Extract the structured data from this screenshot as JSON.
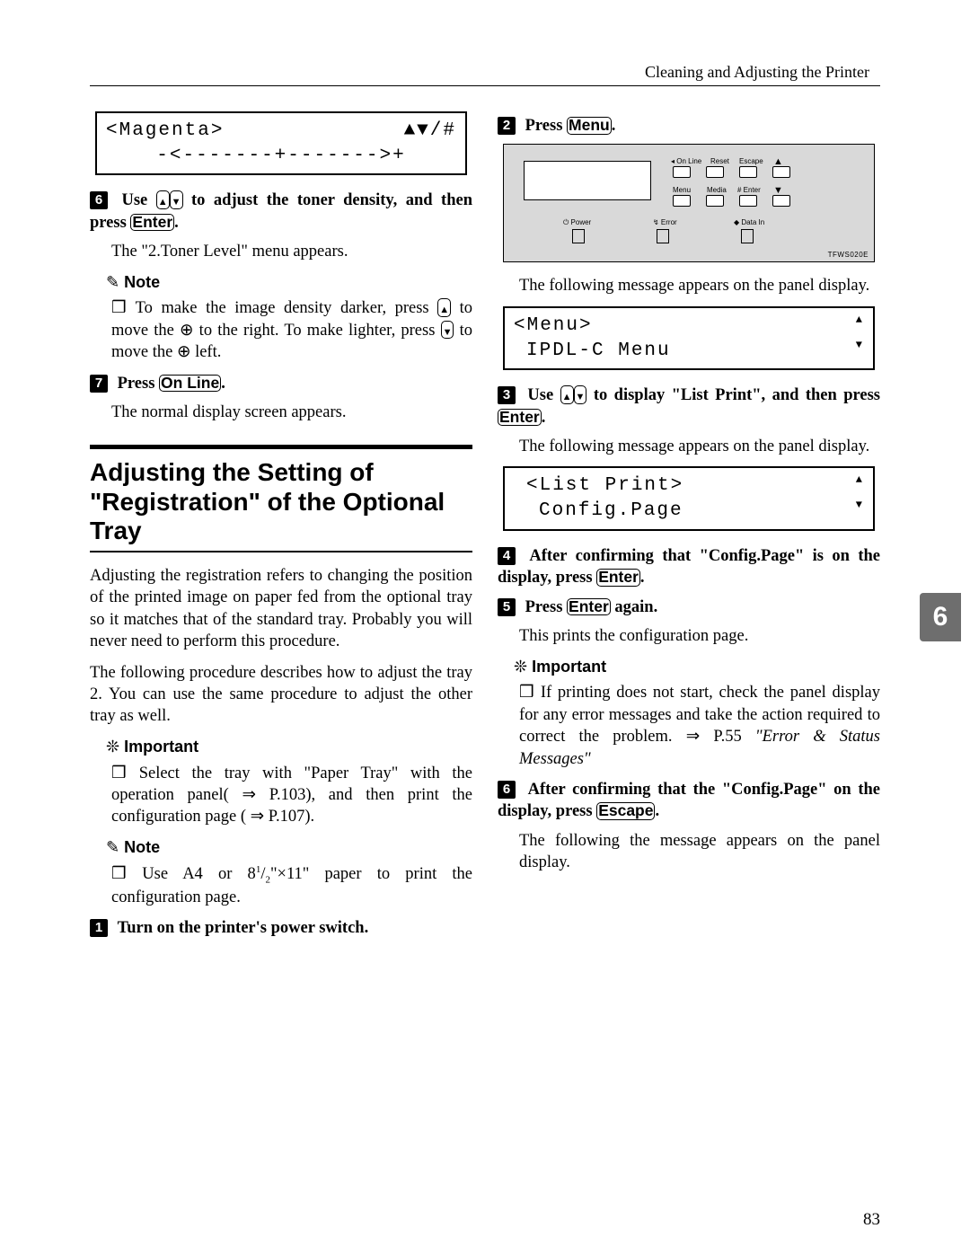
{
  "running_header": "Cleaning and Adjusting the Printer",
  "chapter_tab": "6",
  "page_number": "83",
  "labels": {
    "note": "Note",
    "important": "Important"
  },
  "keys": {
    "enter": "Enter",
    "online": "On Line",
    "menu": "Menu",
    "escape": "Escape"
  },
  "punct": {
    "period": "."
  },
  "panel": {
    "lbl_online": "◂ On Line",
    "lbl_reset": "Reset",
    "lbl_escape": "Escape",
    "lbl_menu": "Menu",
    "lbl_media": "Media",
    "lbl_enter": "# Enter",
    "lbl_power": "⏻ Power",
    "lbl_error": "↯ Error",
    "lbl_datain": "◆ Data In",
    "code": "TFWS020E"
  },
  "left": {
    "lcd1": {
      "title": "<Magenta>",
      "ind": "▲▼/#",
      "bar": "-<-------+------->+"
    },
    "step6": {
      "n": "6",
      "a": "Use",
      "b": "to adjust the toner density, and then press",
      "body": "The \"2.Toner Level\" menu appears."
    },
    "note1": {
      "a": "To make the image density darker, press",
      "b": "to move the ⊕ to the right. To make lighter, press",
      "c": "to move the ⊕ left."
    },
    "step7": {
      "n": "7",
      "a": "Press",
      "body": "The normal display screen appears."
    },
    "h2": "Adjusting the Setting of \"Registration\" of the Optional Tray",
    "p1": "Adjusting the registration refers to changing the position of the printed image on paper fed from the optional tray so it matches that of the standard tray. Probably you will never need to perform this procedure.",
    "p2": "The following procedure describes how to adjust the tray 2. You can use the same procedure to adjust the other tray as well.",
    "imp": {
      "a": "Select the tray with \"Paper Tray\" with the operation panel(",
      "ref1": "⇒ P.103",
      "b": "), and then print the configuration page (",
      "ref2": "⇒ P.107",
      "c": ")."
    },
    "note2": {
      "a": "Use A4 or 8",
      "sup": "1",
      "slash": "/",
      "sub": "2",
      "b": "\"×11\" paper to print the configuration page."
    },
    "step1": {
      "n": "1",
      "text": "Turn on the printer's power switch."
    }
  },
  "right": {
    "step2": {
      "n": "2",
      "a": "Press",
      "body": "The following message appears on the panel display."
    },
    "lcd2": {
      "line1": "<Menu>",
      "line2": "IPDL-C Menu"
    },
    "step3": {
      "n": "3",
      "a": "Use",
      "b": "to display \"List Print\", and then press",
      "body": "The following message appears on the panel display."
    },
    "lcd3": {
      "line1": "<List Print>",
      "line2": "Config.Page"
    },
    "step4": {
      "n": "4",
      "a": "After confirming that \"Config.Page\" is on the display, press"
    },
    "step5": {
      "n": "5",
      "a": "Press",
      "b": "again.",
      "body": "This prints the configuration page."
    },
    "imp": {
      "a": "If printing does not start, check the panel display for any error messages and take the action required to correct the problem.",
      "ref": "⇒ P.55",
      "ital": "\"Error & Status Messages\""
    },
    "step6": {
      "n": "6",
      "a": "After confirming that the \"Config.Page\" on the display, press",
      "body": "The following the message appears on the panel display."
    }
  }
}
